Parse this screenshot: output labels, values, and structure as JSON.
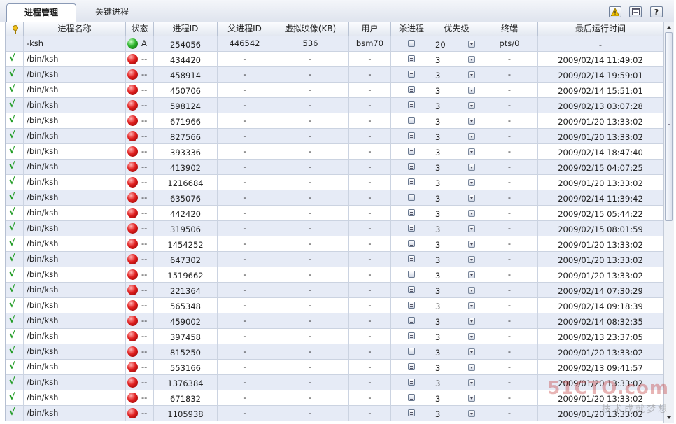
{
  "tabs": [
    {
      "label": "进程管理",
      "active": true
    },
    {
      "label": "关键进程",
      "active": false
    }
  ],
  "toolbar": {
    "icons": [
      "alert-icon",
      "window-icon",
      "help-icon"
    ],
    "help_glyph": "?"
  },
  "columns": [
    "",
    "进程名称",
    "状态",
    "进程ID",
    "父进程ID",
    "虚拟映像(KB)",
    "用户",
    "杀进程",
    "优先级",
    "终端",
    "最后运行时间"
  ],
  "rows": [
    {
      "check": "",
      "name": "-ksh",
      "status": "green",
      "state": "A",
      "pid": "254056",
      "ppid": "446542",
      "vsize": "536",
      "user": "bsm70",
      "priority": "20",
      "tty": "pts/0",
      "last_run": "-"
    },
    {
      "check": "√",
      "name": "/bin/ksh",
      "status": "red",
      "state": "--",
      "pid": "434420",
      "ppid": "-",
      "vsize": "-",
      "user": "-",
      "priority": "3",
      "tty": "-",
      "last_run": "2009/02/14 11:49:02"
    },
    {
      "check": "√",
      "name": "/bin/ksh",
      "status": "red",
      "state": "--",
      "pid": "458914",
      "ppid": "-",
      "vsize": "-",
      "user": "-",
      "priority": "3",
      "tty": "-",
      "last_run": "2009/02/14 19:59:01"
    },
    {
      "check": "√",
      "name": "/bin/ksh",
      "status": "red",
      "state": "--",
      "pid": "450706",
      "ppid": "-",
      "vsize": "-",
      "user": "-",
      "priority": "3",
      "tty": "-",
      "last_run": "2009/02/14 15:51:01"
    },
    {
      "check": "√",
      "name": "/bin/ksh",
      "status": "red",
      "state": "--",
      "pid": "598124",
      "ppid": "-",
      "vsize": "-",
      "user": "-",
      "priority": "3",
      "tty": "-",
      "last_run": "2009/02/13 03:07:28"
    },
    {
      "check": "√",
      "name": "/bin/ksh",
      "status": "red",
      "state": "--",
      "pid": "671966",
      "ppid": "-",
      "vsize": "-",
      "user": "-",
      "priority": "3",
      "tty": "-",
      "last_run": "2009/01/20 13:33:02"
    },
    {
      "check": "√",
      "name": "/bin/ksh",
      "status": "red",
      "state": "--",
      "pid": "827566",
      "ppid": "-",
      "vsize": "-",
      "user": "-",
      "priority": "3",
      "tty": "-",
      "last_run": "2009/01/20 13:33:02"
    },
    {
      "check": "√",
      "name": "/bin/ksh",
      "status": "red",
      "state": "--",
      "pid": "393336",
      "ppid": "-",
      "vsize": "-",
      "user": "-",
      "priority": "3",
      "tty": "-",
      "last_run": "2009/02/14 18:47:40"
    },
    {
      "check": "√",
      "name": "/bin/ksh",
      "status": "red",
      "state": "--",
      "pid": "413902",
      "ppid": "-",
      "vsize": "-",
      "user": "-",
      "priority": "3",
      "tty": "-",
      "last_run": "2009/02/15 04:07:25"
    },
    {
      "check": "√",
      "name": "/bin/ksh",
      "status": "red",
      "state": "--",
      "pid": "1216684",
      "ppid": "-",
      "vsize": "-",
      "user": "-",
      "priority": "3",
      "tty": "-",
      "last_run": "2009/01/20 13:33:02"
    },
    {
      "check": "√",
      "name": "/bin/ksh",
      "status": "red",
      "state": "--",
      "pid": "635076",
      "ppid": "-",
      "vsize": "-",
      "user": "-",
      "priority": "3",
      "tty": "-",
      "last_run": "2009/02/14 11:39:42"
    },
    {
      "check": "√",
      "name": "/bin/ksh",
      "status": "red",
      "state": "--",
      "pid": "442420",
      "ppid": "-",
      "vsize": "-",
      "user": "-",
      "priority": "3",
      "tty": "-",
      "last_run": "2009/02/15 05:44:22"
    },
    {
      "check": "√",
      "name": "/bin/ksh",
      "status": "red",
      "state": "--",
      "pid": "319506",
      "ppid": "-",
      "vsize": "-",
      "user": "-",
      "priority": "3",
      "tty": "-",
      "last_run": "2009/02/15 08:01:59"
    },
    {
      "check": "√",
      "name": "/bin/ksh",
      "status": "red",
      "state": "--",
      "pid": "1454252",
      "ppid": "-",
      "vsize": "-",
      "user": "-",
      "priority": "3",
      "tty": "-",
      "last_run": "2009/01/20 13:33:02"
    },
    {
      "check": "√",
      "name": "/bin/ksh",
      "status": "red",
      "state": "--",
      "pid": "647302",
      "ppid": "-",
      "vsize": "-",
      "user": "-",
      "priority": "3",
      "tty": "-",
      "last_run": "2009/01/20 13:33:02"
    },
    {
      "check": "√",
      "name": "/bin/ksh",
      "status": "red",
      "state": "--",
      "pid": "1519662",
      "ppid": "-",
      "vsize": "-",
      "user": "-",
      "priority": "3",
      "tty": "-",
      "last_run": "2009/01/20 13:33:02"
    },
    {
      "check": "√",
      "name": "/bin/ksh",
      "status": "red",
      "state": "--",
      "pid": "221364",
      "ppid": "-",
      "vsize": "-",
      "user": "-",
      "priority": "3",
      "tty": "-",
      "last_run": "2009/02/14 07:30:29"
    },
    {
      "check": "√",
      "name": "/bin/ksh",
      "status": "red",
      "state": "--",
      "pid": "565348",
      "ppid": "-",
      "vsize": "-",
      "user": "-",
      "priority": "3",
      "tty": "-",
      "last_run": "2009/02/14 09:18:39"
    },
    {
      "check": "√",
      "name": "/bin/ksh",
      "status": "red",
      "state": "--",
      "pid": "459002",
      "ppid": "-",
      "vsize": "-",
      "user": "-",
      "priority": "3",
      "tty": "-",
      "last_run": "2009/02/14 08:32:35"
    },
    {
      "check": "√",
      "name": "/bin/ksh",
      "status": "red",
      "state": "--",
      "pid": "397458",
      "ppid": "-",
      "vsize": "-",
      "user": "-",
      "priority": "3",
      "tty": "-",
      "last_run": "2009/02/13 23:37:05"
    },
    {
      "check": "√",
      "name": "/bin/ksh",
      "status": "red",
      "state": "--",
      "pid": "815250",
      "ppid": "-",
      "vsize": "-",
      "user": "-",
      "priority": "3",
      "tty": "-",
      "last_run": "2009/01/20 13:33:02"
    },
    {
      "check": "√",
      "name": "/bin/ksh",
      "status": "red",
      "state": "--",
      "pid": "553166",
      "ppid": "-",
      "vsize": "-",
      "user": "-",
      "priority": "3",
      "tty": "-",
      "last_run": "2009/02/13 09:41:57"
    },
    {
      "check": "√",
      "name": "/bin/ksh",
      "status": "red",
      "state": "--",
      "pid": "1376384",
      "ppid": "-",
      "vsize": "-",
      "user": "-",
      "priority": "3",
      "tty": "-",
      "last_run": "2009/01/20 13:33:02"
    },
    {
      "check": "√",
      "name": "/bin/ksh",
      "status": "red",
      "state": "--",
      "pid": "671832",
      "ppid": "-",
      "vsize": "-",
      "user": "-",
      "priority": "3",
      "tty": "-",
      "last_run": "2009/01/20 13:33:02"
    },
    {
      "check": "√",
      "name": "/bin/ksh",
      "status": "red",
      "state": "--",
      "pid": "1105938",
      "ppid": "-",
      "vsize": "-",
      "user": "-",
      "priority": "3",
      "tty": "-",
      "last_run": "2009/01/20 13:33:02"
    }
  ],
  "watermark": {
    "line1": "51CTO.com",
    "line2": "技术成就梦想"
  },
  "colors": {
    "check": "#1e9b22",
    "status_ok": "#2fb52f",
    "status_down": "#e12020",
    "row_alt": "#e6ebf6",
    "header_border": "#97a6bf"
  }
}
